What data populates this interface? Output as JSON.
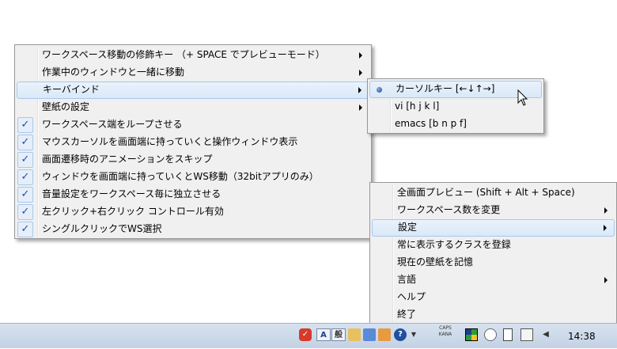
{
  "main_menu": {
    "items": [
      {
        "label": "ワークスペース移動の修飾キー （+ SPACE でプレビューモード）",
        "submenu": true
      },
      {
        "label": "作業中のウィンドウと一緒に移動",
        "submenu": true
      },
      {
        "label": "キーバインド",
        "submenu": true,
        "highlighted": true
      },
      {
        "label": "壁紙の設定",
        "submenu": true
      },
      {
        "label": "ワークスペース端をループさせる",
        "checked": true
      },
      {
        "label": "マウスカーソルを画面端に持っていくと操作ウィンドウ表示",
        "checked": true
      },
      {
        "label": "画面遷移時のアニメーションをスキップ",
        "checked": true
      },
      {
        "label": "ウィンドウを画面端に持っていくとWS移動（32bitアプリのみ）",
        "checked": true
      },
      {
        "label": "音量設定をワークスペース毎に独立させる",
        "checked": true
      },
      {
        "label": "左クリック+右クリック コントロール有効",
        "checked": true
      },
      {
        "label": "シングルクリックでWS選択",
        "checked": true
      }
    ]
  },
  "keybind_menu": {
    "items": [
      {
        "label": "カーソルキー [←↓↑→]",
        "selected": true
      },
      {
        "label": "vi [h j k l]"
      },
      {
        "label": "emacs [b n p f]"
      }
    ]
  },
  "tray_menu": {
    "items": [
      {
        "label": "全画面プレビュー (Shift + Alt + Space)"
      },
      {
        "label": "ワークスペース数を変更",
        "submenu": true
      },
      {
        "label": "設定",
        "submenu": true,
        "highlighted": true
      },
      {
        "label": "常に表示するクラスを登録"
      },
      {
        "label": "現在の壁紙を記憶"
      },
      {
        "label": "言語",
        "submenu": true
      },
      {
        "label": "ヘルプ"
      },
      {
        "label": "終了"
      }
    ]
  },
  "taskbar": {
    "ime_mode": "A",
    "ime_kanji": "般",
    "caps_label": "CAPS",
    "kana_label": "KANA",
    "help_icon": "?",
    "clock": "14:38"
  },
  "colors": {
    "menu_bg": "#f0f0f0",
    "highlight_border": "#a8c8ec",
    "check_color": "#1f4fa0",
    "taskbar_bg": "#c9d7e8"
  }
}
